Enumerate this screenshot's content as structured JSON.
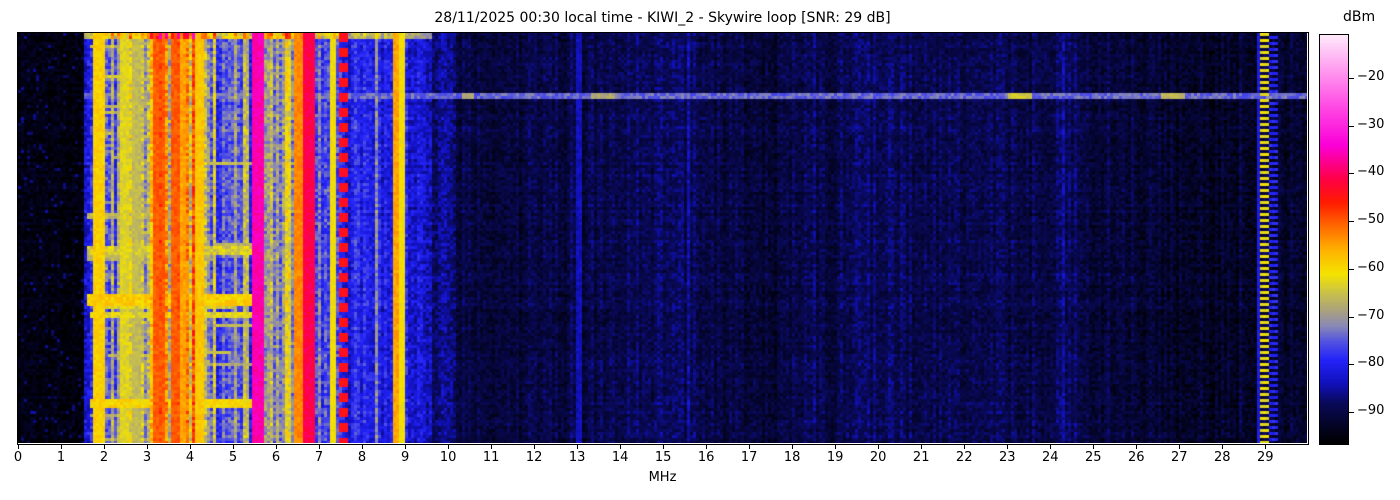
{
  "title": "28/11/2025 00:30 local time - KIWI_2 - Skywire loop [SNR: 29 dB]",
  "chart_data": {
    "type": "heatmap",
    "title": "28/11/2025 00:30 local time - KIWI_2 - Skywire loop [SNR: 29 dB]",
    "xlabel": "MHz",
    "colorbar_label": "dBm",
    "x_ticks": [
      0,
      1,
      2,
      3,
      4,
      5,
      6,
      7,
      8,
      9,
      10,
      11,
      12,
      13,
      14,
      15,
      16,
      17,
      18,
      19,
      20,
      21,
      22,
      23,
      24,
      25,
      26,
      27,
      28,
      29
    ],
    "x_range_mhz": [
      0,
      29.97
    ],
    "colorbar_ticks": [
      -20,
      -30,
      -40,
      -50,
      -60,
      -70,
      -80,
      -90
    ],
    "colorbar_range_dbm": [
      -11,
      -96.5
    ],
    "grid": false,
    "noise_seed": 1337,
    "colormap_stops": [
      [
        -96.5,
        "#000000"
      ],
      [
        -92,
        "#05052e"
      ],
      [
        -88,
        "#0a0a5a"
      ],
      [
        -84,
        "#1111bb"
      ],
      [
        -79,
        "#2424fa"
      ],
      [
        -75,
        "#5555e0"
      ],
      [
        -72,
        "#8888b8"
      ],
      [
        -69,
        "#a89f84"
      ],
      [
        -65,
        "#c9c24a"
      ],
      [
        -61,
        "#f5e400"
      ],
      [
        -56,
        "#ffb300"
      ],
      [
        -51,
        "#ff6a00"
      ],
      [
        -46,
        "#ff1c00"
      ],
      [
        -41,
        "#ff0048"
      ],
      [
        -34,
        "#fb00d8"
      ],
      [
        -26,
        "#ff4ae4"
      ],
      [
        -18,
        "#ff9ef0"
      ],
      [
        -11,
        "#ffeafc"
      ]
    ],
    "bands": [
      {
        "f0": 0.0,
        "f1": 1.5,
        "base": -94.5,
        "jitter": 1.2,
        "stripe_prob": 0.0,
        "stripe_boost": 0,
        "cell_jitter": 2.0
      },
      {
        "f0": 1.5,
        "f1": 2.05,
        "base": -81,
        "jitter": 3.0,
        "stripe_prob": 0.2,
        "stripe_boost": 14,
        "cell_jitter": 4.0
      },
      {
        "f0": 2.05,
        "f1": 2.55,
        "base": -76,
        "jitter": 4.0,
        "stripe_prob": 0.3,
        "stripe_boost": 13,
        "cell_jitter": 4.5
      },
      {
        "f0": 2.55,
        "f1": 3.0,
        "base": -73,
        "jitter": 4.0,
        "stripe_prob": 0.35,
        "stripe_boost": 13,
        "cell_jitter": 4.5
      },
      {
        "f0": 3.0,
        "f1": 4.15,
        "base": -65,
        "jitter": 5.0,
        "stripe_prob": 0.55,
        "stripe_boost": 14,
        "cell_jitter": 5.0
      },
      {
        "f0": 4.15,
        "f1": 4.6,
        "base": -72,
        "jitter": 4.0,
        "stripe_prob": 0.35,
        "stripe_boost": 11,
        "cell_jitter": 4.5
      },
      {
        "f0": 4.6,
        "f1": 5.45,
        "base": -77,
        "jitter": 3.5,
        "stripe_prob": 0.22,
        "stripe_boost": 11,
        "cell_jitter": 4.0
      },
      {
        "f0": 5.45,
        "f1": 5.95,
        "base": -68,
        "jitter": 4.0,
        "stripe_prob": 0.35,
        "stripe_boost": 10,
        "cell_jitter": 4.5
      },
      {
        "f0": 5.95,
        "f1": 6.55,
        "base": -72,
        "jitter": 4.0,
        "stripe_prob": 0.3,
        "stripe_boost": 11,
        "cell_jitter": 4.5
      },
      {
        "f0": 6.55,
        "f1": 7.05,
        "base": -73,
        "jitter": 4.0,
        "stripe_prob": 0.3,
        "stripe_boost": 10,
        "cell_jitter": 4.5
      },
      {
        "f0": 7.05,
        "f1": 7.5,
        "base": -78,
        "jitter": 3.0,
        "stripe_prob": 0.15,
        "stripe_boost": 8,
        "cell_jitter": 4.0
      },
      {
        "f0": 7.5,
        "f1": 8.7,
        "base": -80,
        "jitter": 3.0,
        "stripe_prob": 0.2,
        "stripe_boost": 9,
        "cell_jitter": 3.5
      },
      {
        "f0": 8.7,
        "f1": 9.05,
        "base": -77,
        "jitter": 3.5,
        "stripe_prob": 0.25,
        "stripe_boost": 11,
        "cell_jitter": 4.0
      },
      {
        "f0": 9.05,
        "f1": 9.65,
        "base": -82,
        "jitter": 2.5,
        "stripe_prob": 0.12,
        "stripe_boost": 6,
        "cell_jitter": 3.5
      },
      {
        "f0": 9.65,
        "f1": 10.2,
        "base": -86,
        "jitter": 2.0,
        "stripe_prob": 0.1,
        "stripe_boost": 4,
        "cell_jitter": 3.0
      },
      {
        "f0": 10.2,
        "f1": 29.97,
        "base": -90.5,
        "jitter": 1.8,
        "stripe_prob": 0.06,
        "stripe_boost": 3,
        "cell_jitter": 2.6
      }
    ],
    "carriers_mhz": [
      {
        "f": 1.895,
        "w": 3,
        "level": -59,
        "pattern": "solid"
      },
      {
        "f": 2.46,
        "w": 2,
        "level": -63,
        "pattern": "solid"
      },
      {
        "f": 2.75,
        "w": 2,
        "level": -66,
        "pattern": "solid"
      },
      {
        "f": 3.27,
        "w": 3,
        "level": -50,
        "pattern": "solid"
      },
      {
        "f": 3.63,
        "w": 2,
        "level": -50,
        "pattern": "solid"
      },
      {
        "f": 3.9,
        "w": 2,
        "level": -55,
        "pattern": "solid"
      },
      {
        "f": 4.19,
        "w": 2,
        "level": -58,
        "pattern": "solid"
      },
      {
        "f": 5.59,
        "w": 3,
        "level": -36,
        "pattern": "solid"
      },
      {
        "f": 6.54,
        "w": 2,
        "level": -53,
        "pattern": "solid"
      },
      {
        "f": 6.79,
        "w": 3,
        "level": -41,
        "pattern": "solid"
      },
      {
        "f": 7.3,
        "w": 1,
        "level": -61,
        "pattern": "solid"
      },
      {
        "f": 7.55,
        "w": 2,
        "level": -44,
        "pattern": "dashed"
      },
      {
        "f": 8.87,
        "w": 3,
        "level": -55,
        "pattern": "solid"
      },
      {
        "f": 8.96,
        "w": 1,
        "level": -61,
        "pattern": "solid"
      },
      {
        "f": 13.05,
        "w": 1,
        "level": -84,
        "pattern": "solid"
      },
      {
        "f": 28.85,
        "w": 1,
        "level": -81,
        "pattern": "solid"
      },
      {
        "f": 29.0,
        "w": 2,
        "level": -62,
        "pattern": "dotted"
      },
      {
        "f": 29.22,
        "w": 2,
        "level": -79,
        "pattern": "dotted2"
      }
    ],
    "time_events": [
      {
        "y": 0.0,
        "h": 0.012,
        "f0": 1.55,
        "f1": 9.6,
        "mode": "add",
        "value": 13,
        "jitter": 0
      },
      {
        "y": 0.152,
        "h": 0.008,
        "f0": 1.5,
        "f1": 29.97,
        "mode": "max",
        "value": -74,
        "jitter": 5
      },
      {
        "y": 0.152,
        "h": 0.008,
        "f0": 10.3,
        "f1": 10.6,
        "mode": "max",
        "value": -68,
        "jitter": 3
      },
      {
        "y": 0.152,
        "h": 0.008,
        "f0": 13.3,
        "f1": 13.9,
        "mode": "max",
        "value": -68,
        "jitter": 3
      },
      {
        "y": 0.152,
        "h": 0.008,
        "f0": 23.0,
        "f1": 23.6,
        "mode": "max",
        "value": -64,
        "jitter": 3
      },
      {
        "y": 0.152,
        "h": 0.008,
        "f0": 26.6,
        "f1": 27.1,
        "mode": "max",
        "value": -66,
        "jitter": 3
      },
      {
        "y": 0.44,
        "h": 0.008,
        "f0": 1.6,
        "f1": 3.2,
        "mode": "max",
        "value": -67,
        "jitter": 5
      },
      {
        "y": 0.525,
        "h": 0.012,
        "f0": 1.6,
        "f1": 5.55,
        "mode": "max",
        "value": -64,
        "jitter": 6
      },
      {
        "y": 0.545,
        "h": 0.008,
        "f0": 1.6,
        "f1": 4.5,
        "mode": "max",
        "value": -68,
        "jitter": 6
      },
      {
        "y": 0.64,
        "h": 0.018,
        "f0": 1.6,
        "f1": 5.6,
        "mode": "max",
        "value": -59,
        "jitter": 5
      },
      {
        "y": 0.662,
        "h": 0.008,
        "f0": 1.8,
        "f1": 5.0,
        "mode": "max",
        "value": -64,
        "jitter": 5
      },
      {
        "y": 0.683,
        "h": 0.01,
        "f0": 1.7,
        "f1": 5.5,
        "mode": "max",
        "value": -63,
        "jitter": 6
      },
      {
        "y": 0.895,
        "h": 0.016,
        "f0": 1.7,
        "f1": 5.6,
        "mode": "max",
        "value": -60,
        "jitter": 5
      }
    ]
  }
}
